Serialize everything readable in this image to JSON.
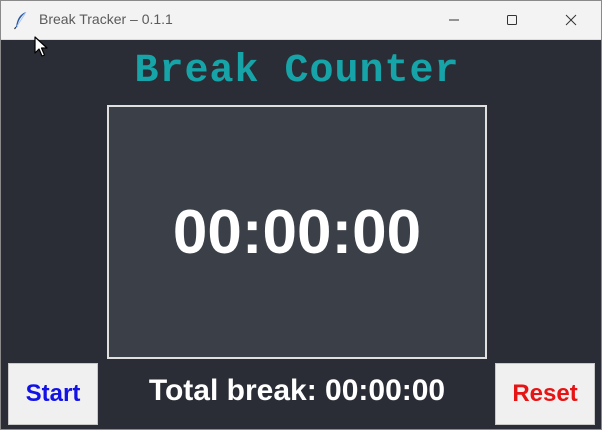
{
  "window": {
    "title": "Break Tracker – 0.1.1",
    "app_icon": "feather-icon",
    "controls": {
      "minimize_icon": "minimize-icon",
      "maximize_icon": "maximize-icon",
      "close_icon": "close-icon"
    }
  },
  "main": {
    "heading": "Break Counter",
    "timer": "00:00:00",
    "total_break": "Total break: 00:00:00",
    "start_label": "Start",
    "reset_label": "Reset"
  },
  "colors": {
    "background": "#2a2d35",
    "timer_panel": "#3b4048",
    "heading": "#16a4a8",
    "start_text": "#1212e6",
    "reset_text": "#e61414",
    "button_face": "#f0f0f0"
  }
}
